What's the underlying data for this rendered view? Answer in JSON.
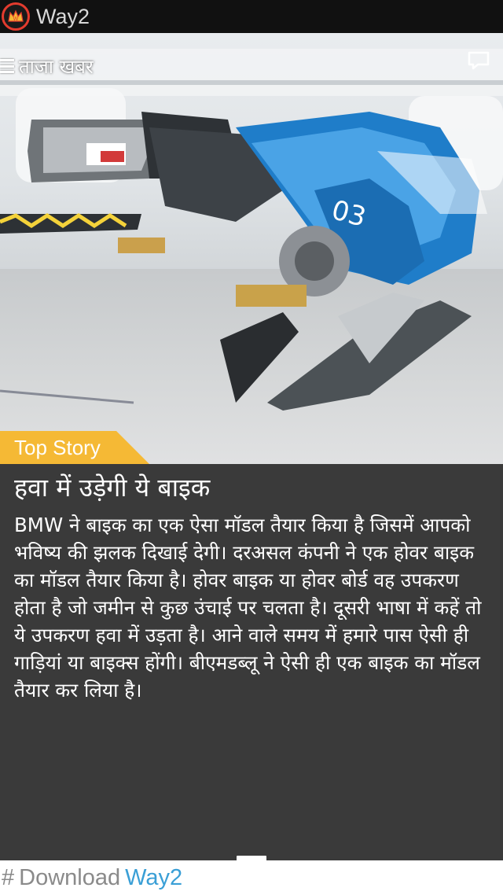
{
  "appbar": {
    "logo_icon": "crown-logo-icon",
    "title": "Way2"
  },
  "hero": {
    "menu_icon": "hamburger-icon",
    "menu_label": "ताजा खबर",
    "comment_icon": "comment-icon",
    "badge": "Top Story",
    "badge_color": "#f5b935"
  },
  "article": {
    "headline": "हवा में उड़ेगी ये बाइक",
    "body": "BMW ने बाइक का एक ऐसा मॉडल तैयार किया है जिसमें आपको भविष्य की झलक दिखाई देगी। दरअसल कंपनी ने एक होवर बाइक का मॉडल तैयार किया है। होवर बाइक या होवर बोर्ड वह उपकरण होता है जो जमीन से कुछ उंचाई पर चलता है। दूसरी भाषा में कहें तो ये उपकरण हवा में उड़ता है। आने वाले समय में हमारे पास ऐसी ही गाड़ियां या बाइक्स होंगी। बीएमडब्लू ने ऐसी ही एक बाइक का मॉडल तैयार कर लिया है।"
  },
  "footer": {
    "hash": "#",
    "text": "Download",
    "brand": "Way2",
    "brand_color": "#3a9fd6"
  }
}
